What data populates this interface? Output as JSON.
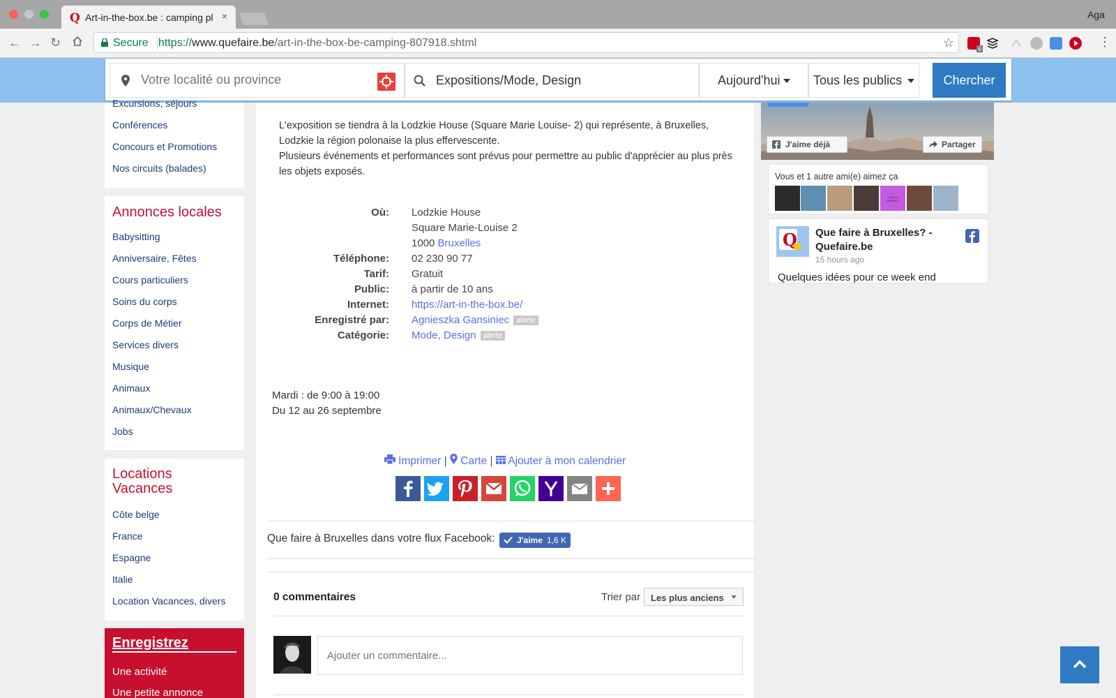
{
  "browser": {
    "tab_title": "Art-in-the-box.be : camping pl",
    "tab_close": "×",
    "profile_name": "Aga",
    "secure_label": "Secure",
    "url_scheme": "https://",
    "url_host": "www.quefaire.be",
    "url_path": "/art-in-the-box-be-camping-807918.shtml",
    "ext_badge": "6"
  },
  "search": {
    "location_placeholder": "Votre localité ou province",
    "category_value": "Expositions/Mode, Design",
    "when_value": "Aujourd'hui",
    "audience_value": "Tous les publics",
    "submit_label": "Chercher"
  },
  "sidebar": {
    "top_links": [
      "Excursions, séjours",
      "Conférences",
      "Concours et Promotions",
      "Nos circuits (balades)"
    ],
    "annonces_title": "Annonces locales",
    "annonces_links": [
      "Babysitting",
      "Anniversaire, Fêtes",
      "Cours particuliers",
      "Soins du corps",
      "Corps de Métier",
      "Services divers",
      "Musique",
      "Animaux",
      "Animaux/Chevaux",
      "Jobs"
    ],
    "locations_title_line1": "Locations",
    "locations_title_line2": "Vacances",
    "locations_links": [
      "Côte belge",
      "France",
      "Espagne",
      "Italie",
      "Location Vacances, divers"
    ],
    "register_title": "Enregistrez",
    "register_links": [
      "Une activité",
      "Une petite annonce"
    ]
  },
  "event": {
    "description": [
      "L'exposition se tiendra à la Lodzkie House (Square Marie Louise- 2) qui représente, à Bruxelles, Lodzkie la région polonaise la plus effervescente.",
      "Plusieurs événements et performances sont prévus pour permettre au public d'apprécier au plus près les objets exposés."
    ],
    "labels": {
      "where": "Où:",
      "phone": "Téléphone:",
      "price": "Tarif:",
      "audience": "Public:",
      "internet": "Internet:",
      "registered_by": "Enregistré par:",
      "category": "Catégorie:"
    },
    "venue": "Lodzkie House",
    "street": "Square Marie-Louise 2",
    "postal_code": "1000",
    "city": "Bruxelles",
    "phone": "02 230 90 77",
    "price": "Gratuit",
    "audience": "à partir de 10 ans",
    "internet": "https://art-in-the-box.be/",
    "registered_by": "Agnieszka Gansiniec",
    "category": "Mode, Design",
    "alert_label": "alerte",
    "hours": "Mardi : de 9:00 à 19:00",
    "dates": "Du 12 au 26 septembre",
    "actions": {
      "print": "Imprimer",
      "map": "Carte",
      "calendar": "Ajouter à mon calendrier",
      "separator": "|"
    },
    "share_icons": [
      "facebook-icon",
      "twitter-icon",
      "pinterest-icon",
      "gmail-icon",
      "whatsapp-icon",
      "yahoo-icon",
      "email-icon",
      "more-icon"
    ]
  },
  "facebook_feed": {
    "label": "Que faire à Bruxelles dans votre flux Facebook:",
    "like_label": "J'aime",
    "like_count": "1,6 K"
  },
  "comments": {
    "count_label": "0 commentaires",
    "sort_label": "Trier par",
    "sort_value": "Les plus anciens",
    "input_placeholder": "Ajouter un commentaire..."
  },
  "fb_widget": {
    "liked_label": "J'aime déjà",
    "share_label": "Partager",
    "friends_text": "Vous et 1 autre ami(e) aimez ça",
    "friend_avatar_text": "LOUIS & FRIENDS",
    "page_name": "Que faire à Bruxelles? - Quefaire.be",
    "post_time": "15 hours ago",
    "post_preview": "Quelques idées pour ce week end"
  },
  "colors": {
    "brand_blue": "#2f7ac3",
    "header_blue": "#8fc1ef",
    "brand_red": "#c8102e",
    "link_blue": "#5a6ee8",
    "sidebar_link": "#1f3a78"
  }
}
